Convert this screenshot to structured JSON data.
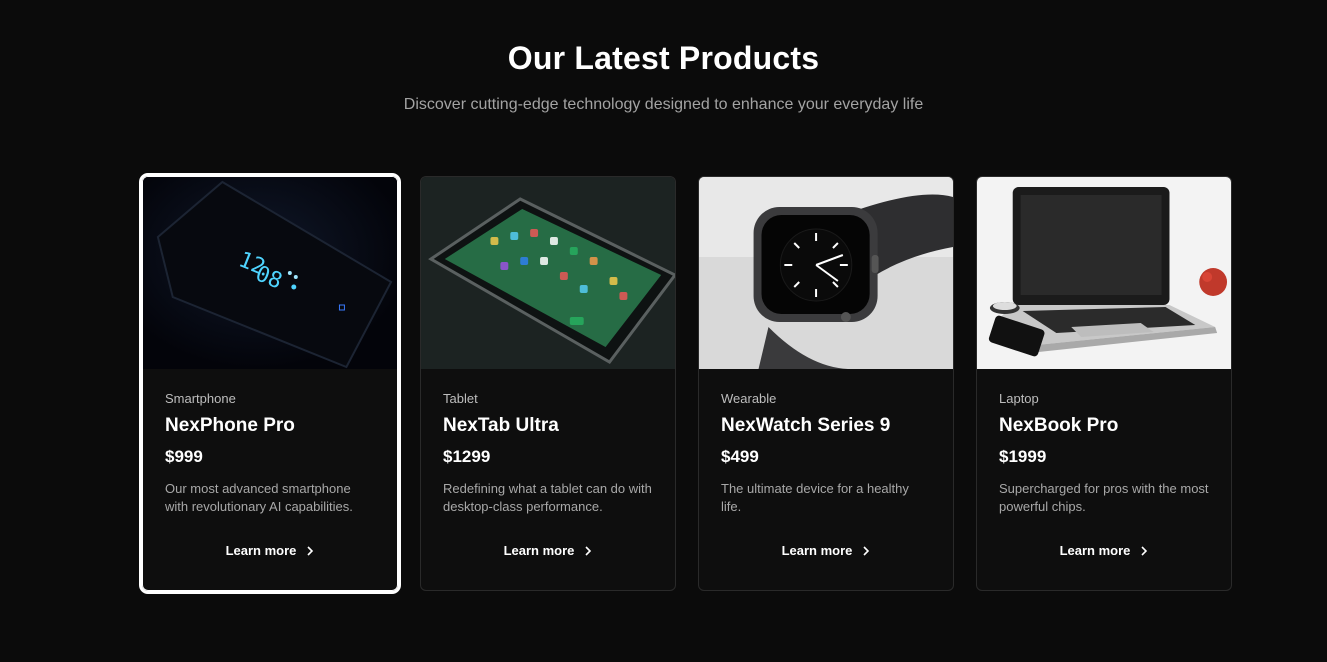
{
  "header": {
    "title": "Our Latest Products",
    "subtitle": "Discover cutting-edge technology designed to enhance your everyday life"
  },
  "products": [
    {
      "category": "Smartphone",
      "name": "NexPhone Pro",
      "price": "$999",
      "description": "Our most advanced smartphone with revolutionary AI capabilities.",
      "cta": "Learn more",
      "image": "smartphone-image",
      "selected": true
    },
    {
      "category": "Tablet",
      "name": "NexTab Ultra",
      "price": "$1299",
      "description": "Redefining what a tablet can do with desktop-class performance.",
      "cta": "Learn more",
      "image": "tablet-image",
      "selected": false
    },
    {
      "category": "Wearable",
      "name": "NexWatch Series 9",
      "price": "$499",
      "description": "The ultimate device for a healthy life.",
      "cta": "Learn more",
      "image": "smartwatch-image",
      "selected": false
    },
    {
      "category": "Laptop",
      "name": "NexBook Pro",
      "price": "$1999",
      "description": "Supercharged for pros with the most powerful chips.",
      "cta": "Learn more",
      "image": "laptop-image",
      "selected": false
    }
  ],
  "colors": {
    "background": "#0b0b0b",
    "card": "#0e0e0e",
    "selected_outline": "#ffffff",
    "muted_text": "#a8a8a8"
  },
  "icons": {
    "cta_icon": "chevron-right-icon"
  }
}
